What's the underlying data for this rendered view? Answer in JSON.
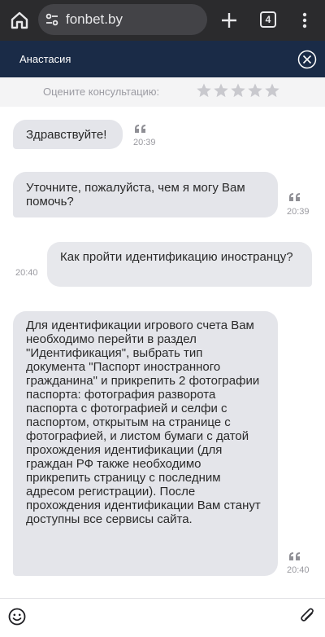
{
  "browser": {
    "url": "fonbet.by",
    "tab_count": "4"
  },
  "chat": {
    "agent_name": "Анастасия",
    "rating_label": "Оцените консультацию:",
    "rating_max": 5,
    "rating_value": 0
  },
  "messages": [
    {
      "direction": "incoming",
      "text": "Здравствуйте!",
      "time": "20:39"
    },
    {
      "direction": "incoming",
      "text": "Уточните, пожалуйста, чем я могу Вам помочь?",
      "time": "20:39"
    },
    {
      "direction": "outgoing",
      "text": "Как пройти идентификацию иностранцу?",
      "time": "20:40"
    },
    {
      "direction": "incoming",
      "text": "Для идентификации игрового счета Вам необходимо перейти в раздел \"Идентификация\", выбрать тип документа \"Паспорт иностранного гражданина\" и прикрепить 2 фотографии паспорта: фотография разворота паспорта с фотографией и селфи с паспортом, открытым на странице с фотографией, и листом бумаги с датой прохождения идентификации (для граждан РФ также необходимо прикрепить страницу с последним адресом регистрации). После прохождения идентификации Вам станут доступны все сервисы сайта.",
      "time": "20:40"
    }
  ],
  "colors": {
    "browser_bar": "#2b2b2d",
    "chat_header": "#1a2b47",
    "bubble": "#e4e5ea"
  }
}
